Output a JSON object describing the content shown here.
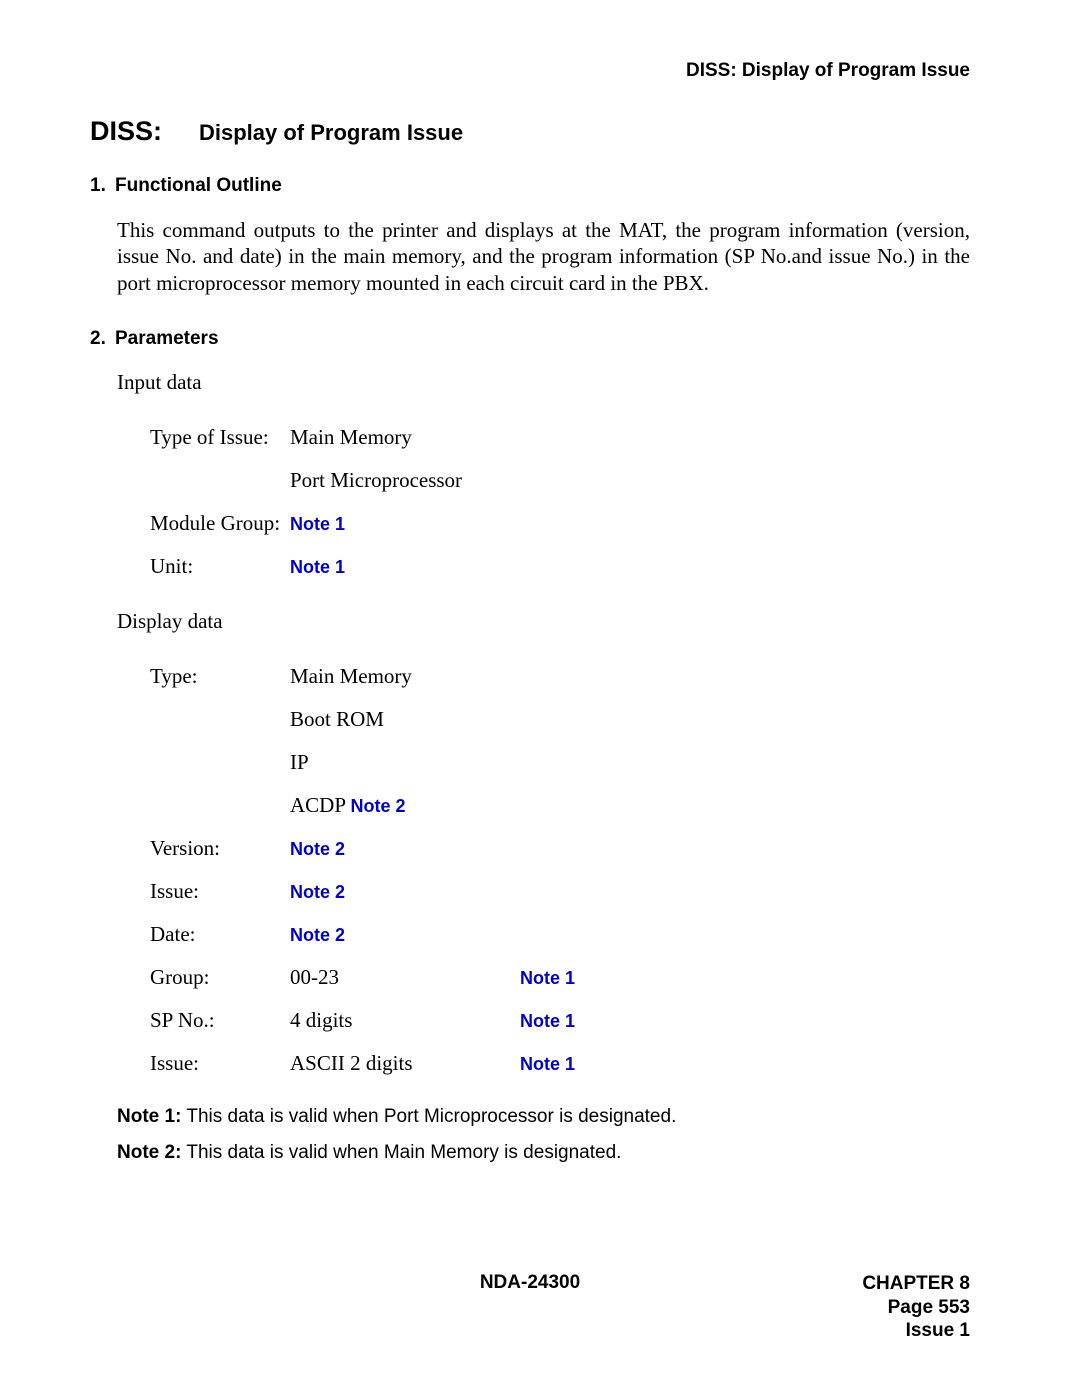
{
  "header": {
    "right": "DISS: Display of Program Issue"
  },
  "title": {
    "code": "DISS:",
    "text": "Display of Program Issue"
  },
  "section1": {
    "num": "1.",
    "heading": "Functional Outline",
    "body": "This command outputs to the printer and displays at the MAT, the program information (version, issue No. and date) in the main memory, and the program information (SP No.and issue No.) in the port microprocessor memory mounted in each circuit card in the PBX."
  },
  "section2": {
    "num": "2.",
    "heading": "Parameters",
    "input_label": "Input data",
    "input_rows": {
      "type_of_issue_label": "Type of Issue:",
      "type_of_issue_v1": "Main Memory",
      "type_of_issue_v2": "Port Microprocessor",
      "module_group_label": "Module Group:",
      "module_group_note": "Note 1",
      "unit_label": "Unit:",
      "unit_note": "Note 1"
    },
    "display_label": "Display data",
    "display_rows": {
      "type_label": "Type:",
      "type_v1": "Main Memory",
      "type_v2": "Boot ROM",
      "type_v3": "IP",
      "type_v4_prefix": "ACDP ",
      "type_v4_note": "Note 2",
      "version_label": "Version:",
      "version_note": "Note 2",
      "issue_label": "Issue:",
      "issue_note": "Note 2",
      "date_label": "Date:",
      "date_note": "Note 2",
      "group_label": "Group:",
      "group_value": "00-23",
      "group_note": "Note 1",
      "spno_label": "SP No.:",
      "spno_value": "4 digits",
      "spno_note": "Note 1",
      "issue2_label": "Issue:",
      "issue2_value": "ASCII 2 digits",
      "issue2_note": "Note 1"
    }
  },
  "notes": {
    "n1_label": "Note 1:",
    "n1_text": "This data is valid when Port Microprocessor is designated.",
    "n2_label": "Note 2:",
    "n2_text": "This data is valid when Main Memory is designated."
  },
  "footer": {
    "center": "NDA-24300",
    "right1": "CHAPTER 8",
    "right2": "Page 553",
    "right3": "Issue 1"
  }
}
